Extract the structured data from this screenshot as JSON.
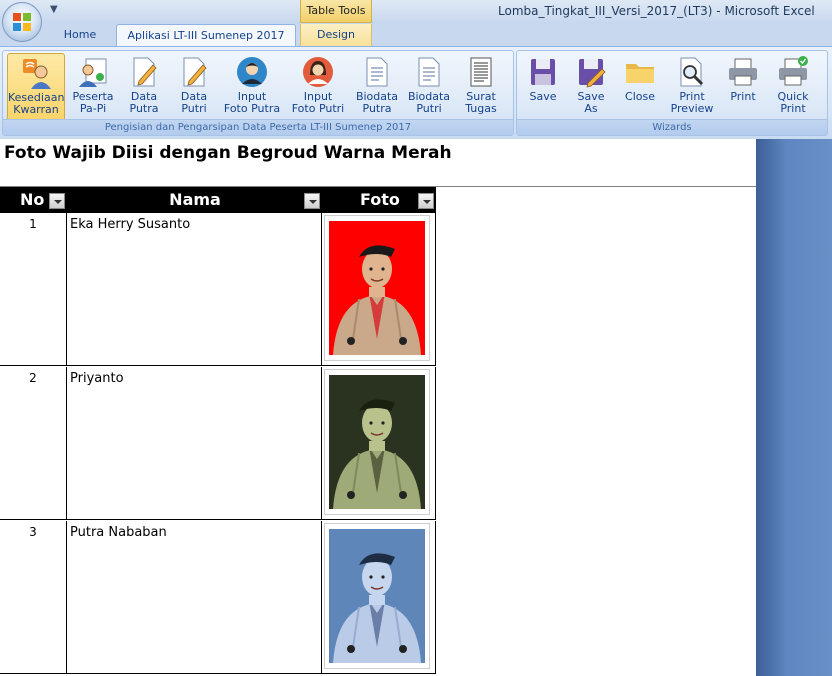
{
  "window": {
    "title": "Lomba_Tingkat_III_Versi_2017_(LT3) - Microsoft Excel",
    "contextual_tab_group": "Table Tools"
  },
  "tabs": [
    {
      "label": "Home"
    },
    {
      "label": "Aplikasi LT-III Sumenep 2017"
    },
    {
      "label": "Design"
    }
  ],
  "ribbon": {
    "group1": {
      "label": "Pengisian dan Pengarsipan Data Peserta LT-III Sumenep 2017",
      "buttons": [
        {
          "line1": "Kesediaan",
          "line2": "Kwarran",
          "icon": "kesediaan-icon"
        },
        {
          "line1": "Peserta",
          "line2": "Pa-Pi",
          "icon": "peserta-icon"
        },
        {
          "line1": "Data",
          "line2": "Putra",
          "icon": "data-edit-icon"
        },
        {
          "line1": "Data",
          "line2": "Putri",
          "icon": "data-edit-icon"
        },
        {
          "line1": "Input",
          "line2": "Foto Putra",
          "icon": "male-avatar-icon"
        },
        {
          "line1": "Input",
          "line2": "Foto Putri",
          "icon": "female-avatar-icon"
        },
        {
          "line1": "Biodata",
          "line2": "Putra",
          "icon": "document-icon"
        },
        {
          "line1": "Biodata",
          "line2": "Putri",
          "icon": "document-icon"
        },
        {
          "line1": "Surat",
          "line2": "Tugas",
          "icon": "document-lines-icon"
        }
      ]
    },
    "group2": {
      "label": "Wizards",
      "buttons": [
        {
          "line1": "Save",
          "line2": "",
          "icon": "save-icon"
        },
        {
          "line1": "Save",
          "line2": "As",
          "icon": "save-as-icon"
        },
        {
          "line1": "Close",
          "line2": "",
          "icon": "folder-icon"
        },
        {
          "line1": "Print",
          "line2": "Preview",
          "icon": "print-preview-icon"
        },
        {
          "line1": "Print",
          "line2": "",
          "icon": "printer-icon"
        },
        {
          "line1": "Quick",
          "line2": "Print",
          "icon": "quick-print-icon"
        }
      ]
    }
  },
  "sheet": {
    "heading": "Foto Wajib Diisi dengan Begroud Warna Merah",
    "columns": [
      "No",
      "Nama",
      "Foto"
    ],
    "rows": [
      {
        "no": "1",
        "nama": "Eka Herry Susanto",
        "bg": "#ff0000",
        "tint": "none"
      },
      {
        "no": "2",
        "nama": "Priyanto",
        "bg": "#2a3320",
        "tint": "green"
      },
      {
        "no": "3",
        "nama": "Putra Nababan",
        "bg": "#5e86b8",
        "tint": "blue"
      }
    ]
  },
  "colors": {
    "ribbon_text": "#15428b",
    "active_button": "#fbd46a",
    "header_bg": "#000000"
  }
}
